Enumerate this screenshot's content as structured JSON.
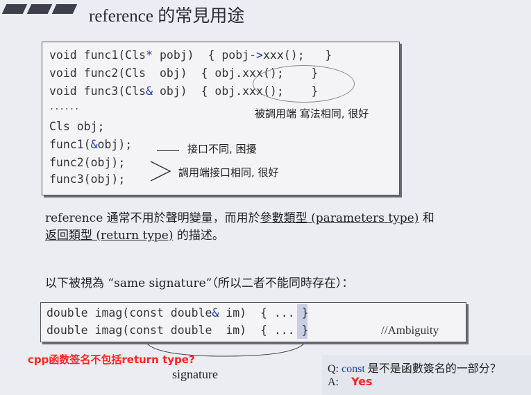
{
  "title": "reference 的常見用途",
  "code": {
    "f1_pre": "void func1(Cls",
    "f1_star": "*",
    "f1_mid": " pobj)  { pobj",
    "f1_arrow": "->",
    "f1_post": "xxx();   }",
    "f2": "void func2(Cls  obj)  { obj.xxx();    }",
    "f3_pre": "void func3(Cls",
    "f3_amp": "&",
    "f3_post": " obj)  { obj.xxx();    }",
    "dots": "......",
    "decl": "Cls obj;",
    "c1_pre": "func1(",
    "c1_amp": "&",
    "c1_post": "obj);",
    "c2": "func2(obj);",
    "c3": "func3(obj);"
  },
  "notes": {
    "caller_same": "被調用端 寫法相同, 很好",
    "interface_diff": "接口不同, 困擾",
    "caller_interface_same": "調用端接口相同, 很好"
  },
  "paragraph": {
    "p1": "reference 通常不用於聲明變量，而用於",
    "p1_u": "參數類型 (parameters type)",
    "p1_end": " 和",
    "p2_u": "返回類型 (return type)",
    "p2_end": " 的描述。"
  },
  "same_sig": "以下被視為 “same signature”（所以二者不能同時存在）：",
  "sig": {
    "l1_pre": "double imag(const double",
    "l1_amp": "&",
    "l1_post": " im)  { ... }",
    "l2": "double imag(const double  im)  { ... }",
    "ambiguity": "//Ambiguity"
  },
  "cpp_note": "cpp函数签名不包括return type?",
  "signature_label": "signature",
  "qa": {
    "q_prefix": "Q: ",
    "q_const": "const",
    "q_rest": " 是不是函數簽名的一部分？",
    "a_prefix": "A:",
    "a_answer": "Yes"
  }
}
